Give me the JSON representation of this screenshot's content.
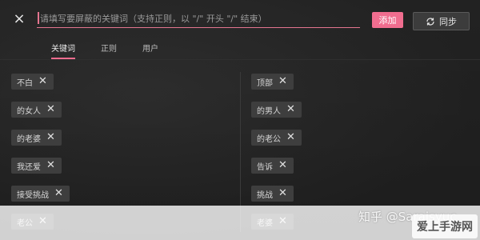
{
  "toolbar": {
    "close_symbol": "×",
    "search_placeholder": "请填写要屏蔽的关键词（支持正则，以 \"/\" 开头 \"/\" 结束）",
    "add_label": "添加",
    "sync_label": "同步"
  },
  "tabs": [
    {
      "label": "关键词",
      "active": true
    },
    {
      "label": "正则",
      "active": false
    },
    {
      "label": "用户",
      "active": false
    }
  ],
  "keywords_left": [
    "不白",
    "的女人",
    "的老婆",
    "我还爱",
    "接受挑战",
    "老公"
  ],
  "keywords_right": [
    "顶部",
    "的男人",
    "的老公",
    "告诉",
    "挑战",
    "老婆"
  ],
  "remove_symbol": "✕",
  "watermark": {
    "text": "知乎 @Saraisyuc",
    "logo": "爱上手游网"
  },
  "colors": {
    "accent": "#f06d8f",
    "background": "#262626",
    "chip": "#3e3e3e"
  },
  "icons": {
    "close": "close-icon",
    "sync": "sync-icon",
    "remove": "remove-icon"
  }
}
